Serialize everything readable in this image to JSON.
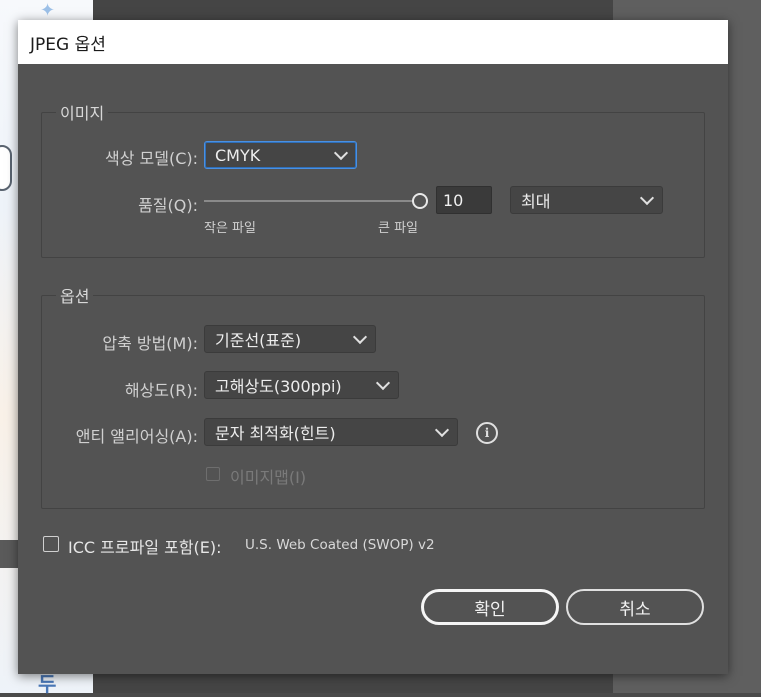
{
  "dialog": {
    "title": "JPEG 옵션",
    "image_group": {
      "legend": "이미지",
      "color_model_label": "색상 모델(C):",
      "color_model_value": "CMYK",
      "quality_label": "품질(Q):",
      "quality_value": "10",
      "quality_preset": "최대",
      "small_file_label": "작은 파일",
      "large_file_label": "큰 파일"
    },
    "options_group": {
      "legend": "옵션",
      "compression_label": "압축 방법(M):",
      "compression_value": "기준선(표준)",
      "resolution_label": "해상도(R):",
      "resolution_value": "고해상도(300ppi)",
      "antialias_label": "앤티 앨리어싱(A):",
      "antialias_value": "문자 최적화(힌트)",
      "imagemap_label": "이미지맵(I)"
    },
    "icc": {
      "label": "ICC 프로파일 포함(E):",
      "profile": "U.S. Web Coated (SWOP) v2"
    },
    "buttons": {
      "ok": "확인",
      "cancel": "취소"
    }
  },
  "background": {
    "glyph": "두"
  }
}
